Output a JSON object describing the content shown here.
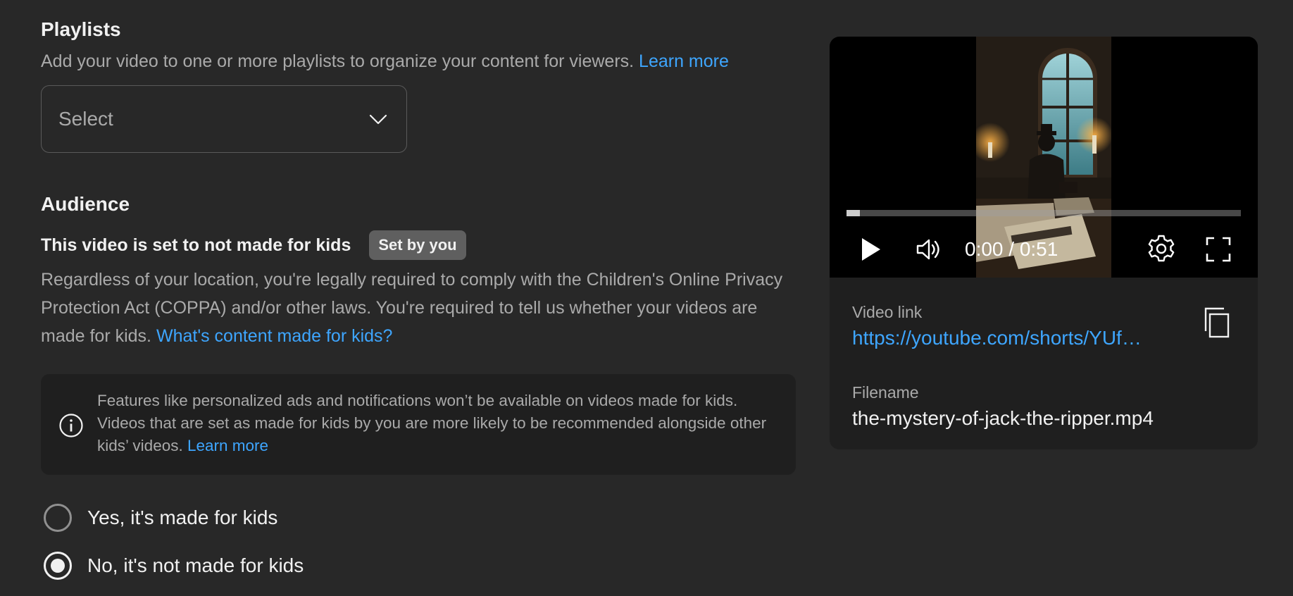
{
  "playlists": {
    "title": "Playlists",
    "description": "Add your video to one or more playlists to organize your content for viewers.",
    "learn_more": "Learn more",
    "select_placeholder": "Select"
  },
  "audience": {
    "title": "Audience",
    "status": "This video is set to not made for kids",
    "badge": "Set by you",
    "coppa_text": "Regardless of your location, you're legally required to comply with the Children's Online Privacy Protection Act (COPPA) and/or other laws. You're required to tell us whether your videos are made for kids.",
    "coppa_link": "What's content made for kids?",
    "info_text": "Features like personalized ads and notifications won’t be available on videos made for kids. Videos that are set as made for kids by you are more likely to be recommended alongside other kids’ videos.",
    "info_link": "Learn more",
    "options": [
      {
        "label": "Yes, it's made for kids",
        "selected": false
      },
      {
        "label": "No, it's not made for kids",
        "selected": true
      }
    ]
  },
  "player": {
    "time": "0:00 / 0:51",
    "progress": 0.034,
    "icons": [
      "play-icon",
      "volume-icon",
      "settings-gear-icon",
      "fullscreen-icon"
    ]
  },
  "details": {
    "video_link_label": "Video link",
    "video_link": "https://youtube.com/shorts/YUf…",
    "filename_label": "Filename",
    "filename": "the-mystery-of-jack-the-ripper.mp4",
    "copy_icon": "copy-icon"
  },
  "colors": {
    "background": "#282828",
    "panel": "#1f1f1f",
    "link": "#3ea6ff",
    "secondary_text": "#aaaaaa",
    "primary_text": "#f1f1f1"
  }
}
